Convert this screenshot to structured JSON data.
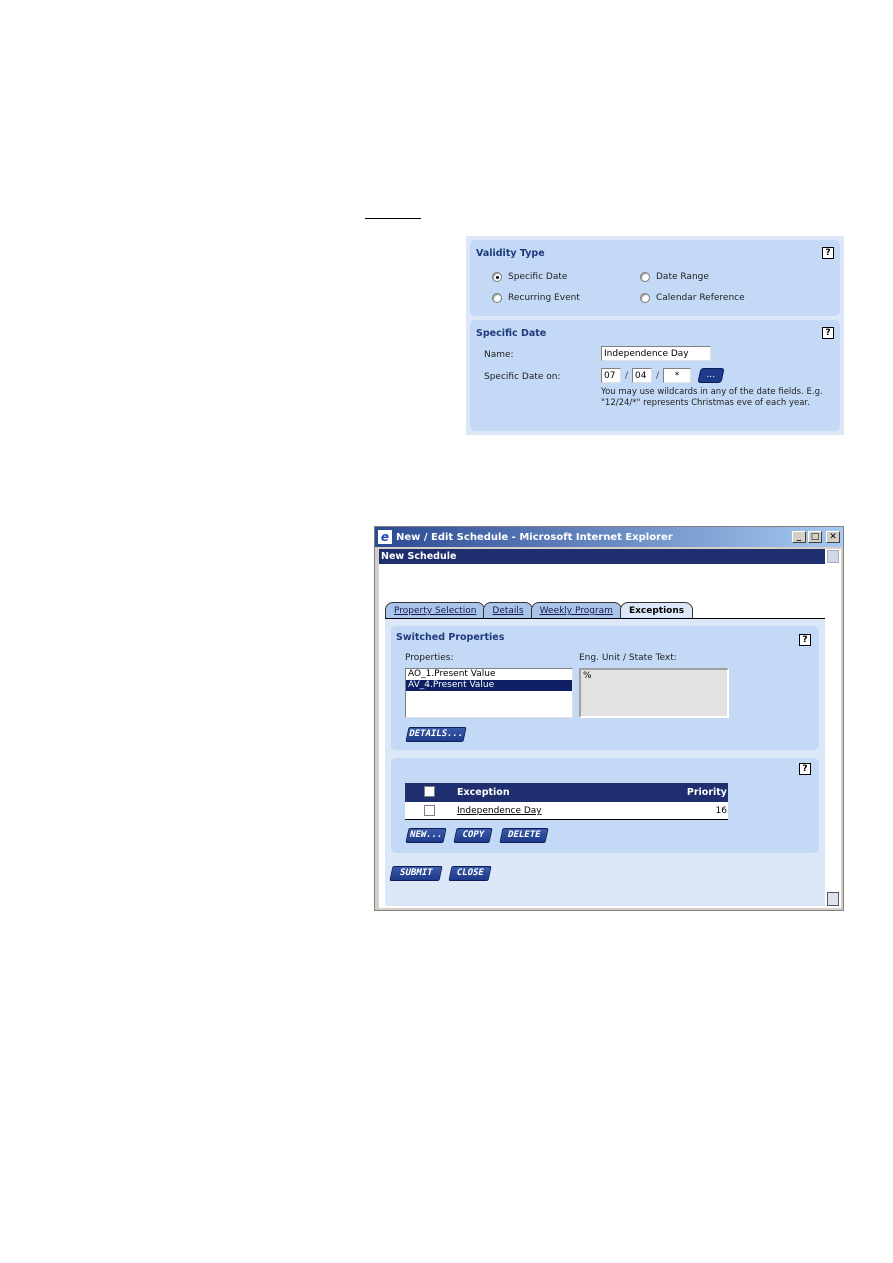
{
  "validity_type": {
    "title": "Validity Type",
    "help": "?",
    "options": [
      {
        "label": "Specific Date",
        "checked": true
      },
      {
        "label": "Date Range",
        "checked": false
      },
      {
        "label": "Recurring Event",
        "checked": false
      },
      {
        "label": "Calendar Reference",
        "checked": false
      }
    ]
  },
  "specific_date": {
    "title": "Specific Date",
    "help": "?",
    "name_label": "Name:",
    "name_value": "Independence Day",
    "date_label": "Specific Date on:",
    "month": "07",
    "day": "04",
    "year": "*",
    "separator": "/",
    "calendar_button": "...",
    "hint": "You may use wildcards in any of the date fields. E.g. \"12/24/*\" represents Christmas eve of each year."
  },
  "window": {
    "title": "New / Edit Schedule - Microsoft Internet Explorer",
    "logo": "e",
    "minimize": "_",
    "maximize": "□",
    "close": "✕",
    "page_header": "New Schedule",
    "tabs": [
      {
        "label": "Property Selection",
        "active": false
      },
      {
        "label": "Details",
        "active": false
      },
      {
        "label": "Weekly Program",
        "active": false
      },
      {
        "label": "Exceptions",
        "active": true
      }
    ]
  },
  "switched_properties": {
    "title": "Switched Properties",
    "help": "?",
    "properties_label": "Properties:",
    "properties": [
      {
        "label": "AO_1.Present Value",
        "selected": false
      },
      {
        "label": "AV_4.Present Value",
        "selected": true
      }
    ],
    "unit_label": "Eng. Unit / State Text:",
    "unit_value": "%",
    "details_button": "DETAILS..."
  },
  "exceptions": {
    "help": "?",
    "columns": [
      "Exception",
      "Priority"
    ],
    "rows": [
      {
        "exception": "Independence Day",
        "priority": "16"
      }
    ],
    "new_button": "NEW...",
    "copy_button": "COPY",
    "delete_button": "DELETE"
  },
  "footer": {
    "submit_button": "SUBMIT",
    "close_button": "CLOSE"
  }
}
